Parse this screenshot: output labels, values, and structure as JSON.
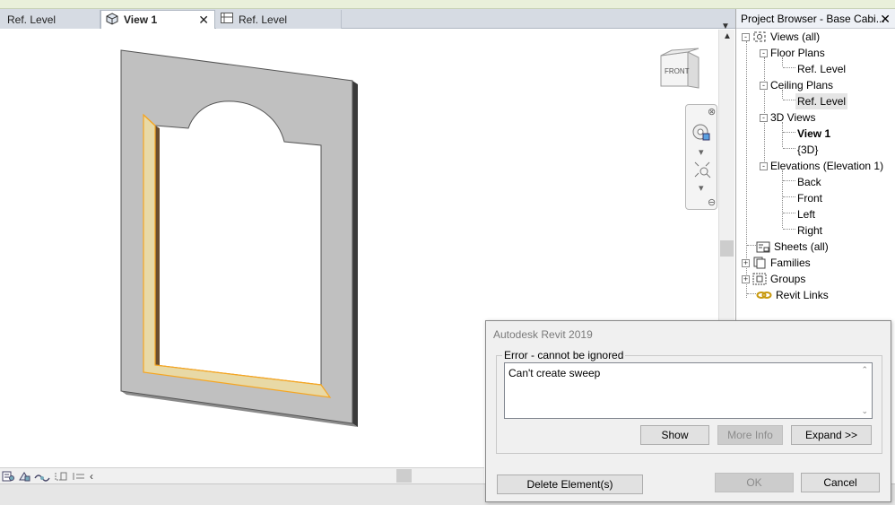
{
  "tabs": [
    {
      "label": "Ref. Level",
      "active": false,
      "icon": "floor-plan-icon"
    },
    {
      "label": "View 1",
      "active": true,
      "icon": "3d-view-icon"
    },
    {
      "label": "Ref. Level",
      "active": false,
      "icon": "ceiling-plan-icon"
    }
  ],
  "tab_close_glyph": "✕",
  "tab_menu_glyph": "▼",
  "viewcube": {
    "face_label": "FRONT"
  },
  "project_browser": {
    "title": "Project Browser - Base Cabi...",
    "close_glyph": "✕",
    "items": [
      {
        "label": "Views (all)",
        "level": 0,
        "expander": "-",
        "icon": "views-icon"
      },
      {
        "label": "Floor Plans",
        "level": 1,
        "expander": "-"
      },
      {
        "label": "Ref. Level",
        "level": 2
      },
      {
        "label": "Ceiling Plans",
        "level": 1,
        "expander": "-"
      },
      {
        "label": "Ref. Level",
        "level": 2,
        "selected": true
      },
      {
        "label": "3D Views",
        "level": 1,
        "expander": "-"
      },
      {
        "label": "View 1",
        "level": 2,
        "bold": true
      },
      {
        "label": "{3D}",
        "level": 2
      },
      {
        "label": "Elevations (Elevation 1)",
        "level": 1,
        "expander": "-"
      },
      {
        "label": "Back",
        "level": 2
      },
      {
        "label": "Front",
        "level": 2
      },
      {
        "label": "Left",
        "level": 2
      },
      {
        "label": "Right",
        "level": 2
      },
      {
        "label": "Sheets (all)",
        "level": 0,
        "icon": "sheets-icon"
      },
      {
        "label": "Families",
        "level": 0,
        "expander": "+",
        "icon": "families-icon"
      },
      {
        "label": "Groups",
        "level": 0,
        "expander": "+",
        "icon": "groups-icon"
      },
      {
        "label": "Revit Links",
        "level": 0,
        "icon": "revit-links-icon"
      }
    ]
  },
  "dialog": {
    "title": "Autodesk Revit 2019",
    "group_label": "Error - cannot be ignored",
    "message": "Can't create sweep",
    "buttons": {
      "show": "Show",
      "more_info": "More Info",
      "expand": "Expand >>",
      "delete": "Delete Element(s)",
      "ok": "OK",
      "cancel": "Cancel"
    }
  },
  "colors": {
    "panel_face": "#c0c0c0",
    "panel_edge": "#555555",
    "highlight_orange": "#f5a623",
    "sweep_fill": "#e8d9a6"
  }
}
